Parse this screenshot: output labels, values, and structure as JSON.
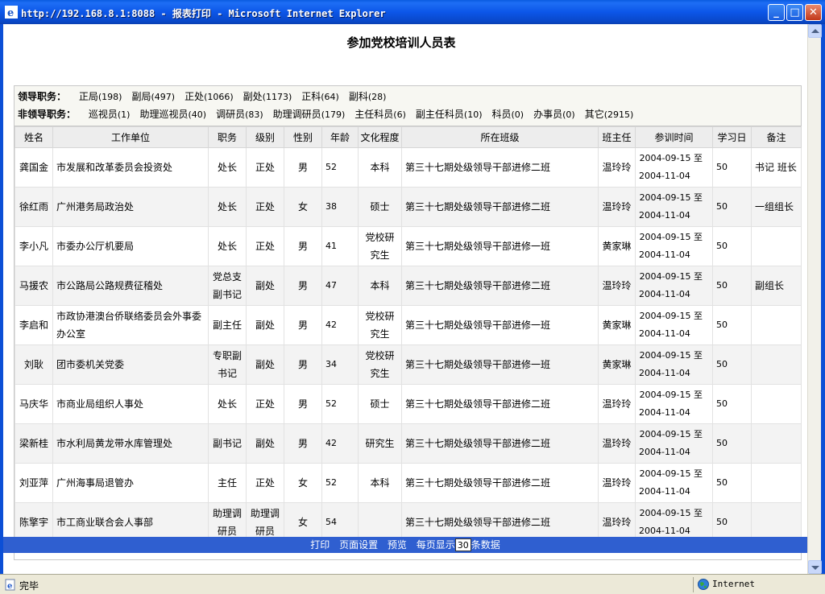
{
  "window": {
    "title": "http://192.168.8.1:8088 - 报表打印 - Microsoft Internet Explorer",
    "minimize_glyph": "_",
    "maximize_glyph": "□",
    "close_glyph": "✕"
  },
  "page": {
    "title": "参加党校培训人员表"
  },
  "filters": {
    "leader": {
      "label": "领导职务：",
      "items": [
        {
          "name": "正局",
          "count": "(198)"
        },
        {
          "name": "副局",
          "count": "(497)"
        },
        {
          "name": "正处",
          "count": "(1066)"
        },
        {
          "name": "副处",
          "count": "(1173)"
        },
        {
          "name": "正科",
          "count": "(64)"
        },
        {
          "name": "副科",
          "count": "(28)"
        }
      ]
    },
    "non_leader": {
      "label": "非领导职务：",
      "items": [
        {
          "name": "巡视员",
          "count": "(1)"
        },
        {
          "name": "助理巡视员",
          "count": "(40)"
        },
        {
          "name": "调研员",
          "count": "(83)"
        },
        {
          "name": "助理调研员",
          "count": "(179)"
        },
        {
          "name": "主任科员",
          "count": "(6)"
        },
        {
          "name": "副主任科员",
          "count": "(10)"
        },
        {
          "name": "科员",
          "count": "(0)"
        },
        {
          "name": "办事员",
          "count": "(0)"
        },
        {
          "name": "其它",
          "count": "(2915)"
        }
      ]
    }
  },
  "table": {
    "headers": [
      "姓名",
      "工作单位",
      "职务",
      "级别",
      "性别",
      "年龄",
      "文化程度",
      "所在班级",
      "班主任",
      "参训时间",
      "学习日",
      "备注"
    ],
    "rows": [
      {
        "name": "龚国金",
        "unit": "市发展和改革委员会投资处",
        "post": "处长",
        "level": "正处",
        "sex": "男",
        "age": "52",
        "edu": "本科",
        "class": "第三十七期处级领导干部进修二班",
        "teacher": "温玲玲",
        "time_from": "2004-09-15 至",
        "time_to": "2004-11-04",
        "days": "50",
        "note": "书记 班长"
      },
      {
        "name": "徐红雨",
        "unit": "广州港务局政治处",
        "post": "处长",
        "level": "正处",
        "sex": "女",
        "age": "38",
        "edu": "硕士",
        "class": "第三十七期处级领导干部进修二班",
        "teacher": "温玲玲",
        "time_from": "2004-09-15 至",
        "time_to": "2004-11-04",
        "days": "50",
        "note": "一组组长"
      },
      {
        "name": "李小凡",
        "unit": "市委办公厅机要局",
        "post": "处长",
        "level": "正处",
        "sex": "男",
        "age": "41",
        "edu": "党校研究生",
        "class": "第三十七期处级领导干部进修一班",
        "teacher": "黄家琳",
        "time_from": "2004-09-15 至",
        "time_to": "2004-11-04",
        "days": "50",
        "note": ""
      },
      {
        "name": "马援农",
        "unit": "市公路局公路规费征稽处",
        "post": "党总支副书记",
        "level": "副处",
        "sex": "男",
        "age": "47",
        "edu": "本科",
        "class": "第三十七期处级领导干部进修二班",
        "teacher": "温玲玲",
        "time_from": "2004-09-15 至",
        "time_to": "2004-11-04",
        "days": "50",
        "note": "副组长"
      },
      {
        "name": "李启和",
        "unit": "市政协港澳台侨联络委员会外事委办公室",
        "post": "副主任",
        "level": "副处",
        "sex": "男",
        "age": "42",
        "edu": "党校研究生",
        "class": "第三十七期处级领导干部进修一班",
        "teacher": "黄家琳",
        "time_from": "2004-09-15 至",
        "time_to": "2004-11-04",
        "days": "50",
        "note": ""
      },
      {
        "name": "刘耿",
        "unit": "团市委机关党委",
        "post": "专职副书记",
        "level": "副处",
        "sex": "男",
        "age": "34",
        "edu": "党校研究生",
        "class": "第三十七期处级领导干部进修一班",
        "teacher": "黄家琳",
        "time_from": "2004-09-15 至",
        "time_to": "2004-11-04",
        "days": "50",
        "note": ""
      },
      {
        "name": "马庆华",
        "unit": "市商业局组织人事处",
        "post": "处长",
        "level": "正处",
        "sex": "男",
        "age": "52",
        "edu": "硕士",
        "class": "第三十七期处级领导干部进修二班",
        "teacher": "温玲玲",
        "time_from": "2004-09-15 至",
        "time_to": "2004-11-04",
        "days": "50",
        "note": ""
      },
      {
        "name": "梁新桂",
        "unit": "市水利局黄龙带水库管理处",
        "post": "副书记",
        "level": "副处",
        "sex": "男",
        "age": "42",
        "edu": "研究生",
        "class": "第三十七期处级领导干部进修二班",
        "teacher": "温玲玲",
        "time_from": "2004-09-15 至",
        "time_to": "2004-11-04",
        "days": "50",
        "note": ""
      },
      {
        "name": "刘亚萍",
        "unit": "广州海事局退管办",
        "post": "主任",
        "level": "正处",
        "sex": "女",
        "age": "52",
        "edu": "本科",
        "class": "第三十七期处级领导干部进修二班",
        "teacher": "温玲玲",
        "time_from": "2004-09-15 至",
        "time_to": "2004-11-04",
        "days": "50",
        "note": ""
      },
      {
        "name": "陈擎宇",
        "unit": "市工商业联合会人事部",
        "post": "助理调研员",
        "level": "助理调研员",
        "sex": "女",
        "age": "54",
        "edu": "",
        "class": "第三十七期处级领导干部进修二班",
        "teacher": "温玲玲",
        "time_from": "2004-09-15 至",
        "time_to": "2004-11-04",
        "days": "50",
        "note": ""
      }
    ]
  },
  "printbar": {
    "print": "打印",
    "page_setup": "页面设置",
    "preview": "预览",
    "per_page_prefix": "每页显示",
    "per_page_value": "30",
    "per_page_suffix": "条数据"
  },
  "statusbar": {
    "status": "完毕",
    "zone": "Internet"
  },
  "colors": {
    "titlebar": "#0c56e8",
    "printbar": "#2f5fd0",
    "header_bg": "#ededed"
  }
}
